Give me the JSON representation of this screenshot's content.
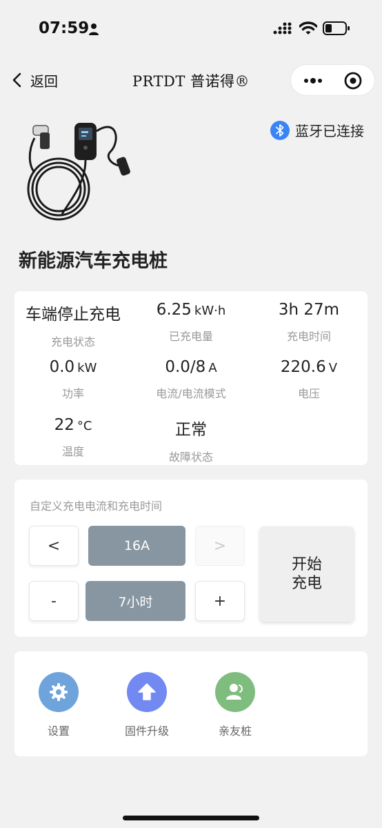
{
  "status_bar": {
    "time": "07:59"
  },
  "nav": {
    "back_label": "返回",
    "title": "PRTDT 普诺得®"
  },
  "bluetooth": {
    "label": "蓝牙已连接",
    "color": "#3a84f5"
  },
  "page_title": "新能源汽车充电桩",
  "info": [
    {
      "value": "车端停止充电",
      "unit": "",
      "label": "充电状态"
    },
    {
      "value": "6.25",
      "unit": "kW·h",
      "label": "已充电量"
    },
    {
      "value": "3h 27m",
      "unit": "",
      "label": "充电时间"
    },
    {
      "value": "0.0",
      "unit": "kW",
      "label": "功率"
    },
    {
      "value": "0.0/8",
      "unit": "A",
      "label": "电流/电流模式"
    },
    {
      "value": "220.6",
      "unit": "V",
      "label": "电压"
    },
    {
      "value": "22",
      "unit": "°C",
      "label": "温度"
    },
    {
      "value": "正常",
      "unit": "",
      "label": "故障状态"
    }
  ],
  "control": {
    "title": "自定义充电电流和充电时间",
    "current_prev": "<",
    "current_value": "16A",
    "current_next": ">",
    "time_minus": "-",
    "time_value": "7小时",
    "time_plus": "+",
    "start_label": "开始充电"
  },
  "menu": [
    {
      "label": "设置",
      "icon": "gear-icon",
      "color": "#6fa3dc"
    },
    {
      "label": "固件升级",
      "icon": "upload-arrow-icon",
      "color": "#7189f1"
    },
    {
      "label": "亲友桩",
      "icon": "user-share-icon",
      "color": "#7fbd7f"
    }
  ]
}
